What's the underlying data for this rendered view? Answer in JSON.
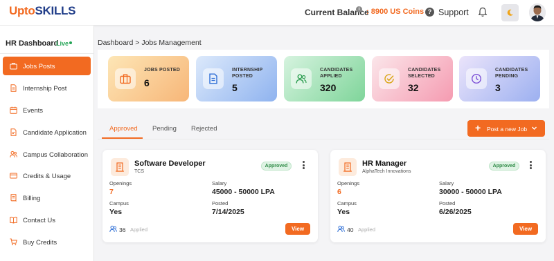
{
  "header": {
    "logo": {
      "upto": "Upto",
      "skills": "SKILLS"
    },
    "balance_label": "Current Balance",
    "balance_value": ": 8900 US Coins",
    "support_label": "Support"
  },
  "sidebar": {
    "title": "HR Dashboard",
    "live_label": "Live",
    "items": [
      {
        "label": "Jobs Posts",
        "icon": "briefcase-icon",
        "active": true
      },
      {
        "label": "Internship Post",
        "icon": "document-icon"
      },
      {
        "label": "Events",
        "icon": "calendar-icon"
      },
      {
        "label": "Candidate Application",
        "icon": "file-icon"
      },
      {
        "label": "Campus Collaboration",
        "icon": "users-icon"
      },
      {
        "label": "Credits & Usage",
        "icon": "card-icon"
      },
      {
        "label": "Billing",
        "icon": "receipt-icon"
      },
      {
        "label": "Contact Us",
        "icon": "book-icon"
      },
      {
        "label": "Buy Credits",
        "icon": "cart-icon"
      }
    ]
  },
  "breadcrumb": "Dashboard > Jobs Management",
  "stats": [
    {
      "label": "JOBS POSTED",
      "value": "6",
      "icon": "briefcase-icon",
      "color": "#f26a21"
    },
    {
      "label": "INTERNSHIP POSTED",
      "value": "5",
      "icon": "document-icon",
      "color": "#2f6fd6"
    },
    {
      "label": "CANDIDATES APPLIED",
      "value": "320",
      "icon": "users-icon",
      "color": "#2e9e52"
    },
    {
      "label": "CANDIDATES SELECTED",
      "value": "32",
      "icon": "check-circle-icon",
      "color": "#d9a514"
    },
    {
      "label": "CANDIDATES PENDING",
      "value": "3",
      "icon": "clock-icon",
      "color": "#7b4fd6"
    }
  ],
  "tabs": [
    {
      "label": "Approved",
      "active": true
    },
    {
      "label": "Pending"
    },
    {
      "label": "Rejected"
    }
  ],
  "post_button": "Post a new Job",
  "field_labels": {
    "openings": "Openings",
    "salary": "Salary",
    "campus": "Campus",
    "posted": "Posted"
  },
  "jobs": [
    {
      "title": "Software Developer",
      "company": "TCS",
      "status": "Approved",
      "openings": "7",
      "salary": "45000 - 50000 LPA",
      "campus": "Yes",
      "posted": "7/14/2025",
      "applied_count": "36",
      "applied_label": "Applied",
      "view_label": "View"
    },
    {
      "title": "HR Manager",
      "company": "AlphaTech Innovations",
      "status": "Approved",
      "openings": "6",
      "salary": "30000 - 50000 LPA",
      "campus": "Yes",
      "posted": "6/26/2025",
      "applied_count": "40",
      "applied_label": "Applied",
      "view_label": "View"
    }
  ],
  "colors": {
    "accent": "#f26a21",
    "success": "#2d8a45",
    "brand_blue": "#1f3c88"
  }
}
